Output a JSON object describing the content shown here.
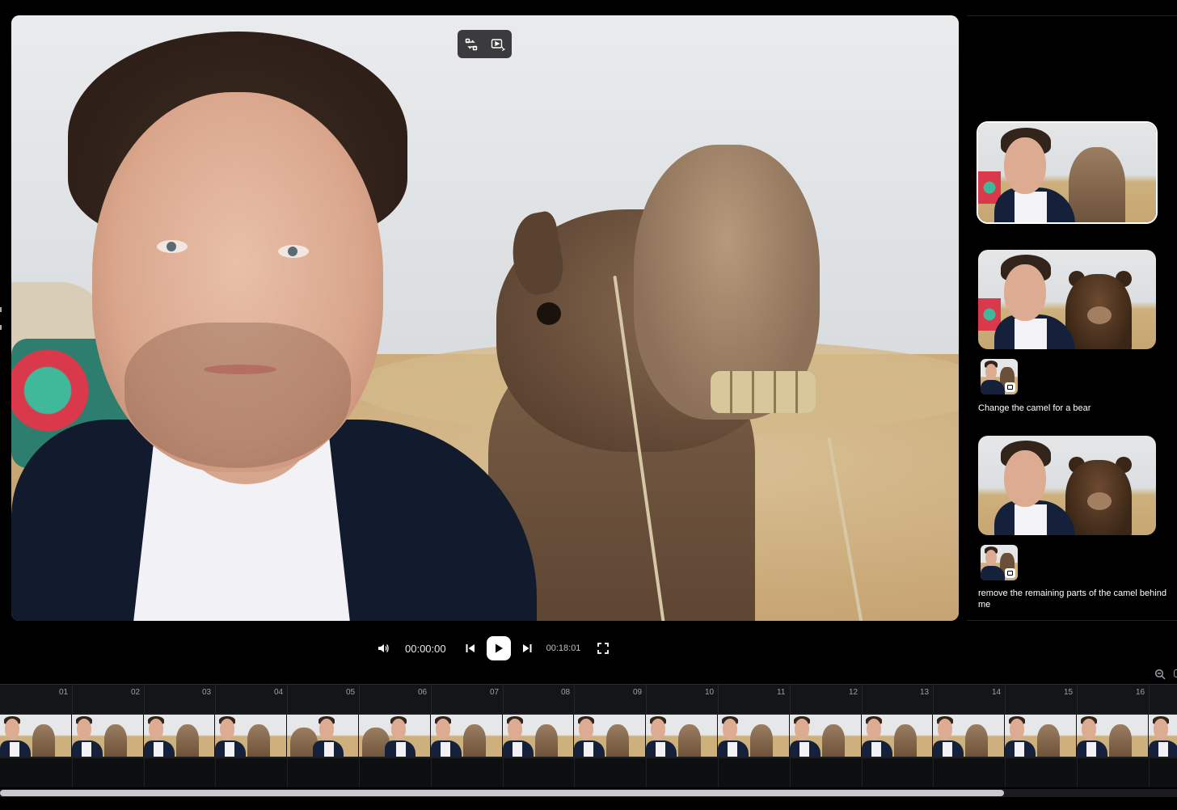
{
  "player": {
    "current_time": "00:00:00",
    "duration": "00:18:01"
  },
  "preview_toolbar": {
    "icons": [
      "swap-compare-icon",
      "video-ai-icon"
    ]
  },
  "history": {
    "items": [
      {
        "variant": "original-camel",
        "prompt": ""
      },
      {
        "variant": "bear",
        "prompt": "Change the camel for a bear"
      },
      {
        "variant": "bear-cleaned",
        "prompt": "remove the remaining parts of the camel behind me"
      }
    ]
  },
  "timeline": {
    "ruler_labels": [
      "01",
      "02",
      "03",
      "04",
      "05",
      "06",
      "07",
      "08",
      "09",
      "10",
      "11",
      "12",
      "13",
      "14",
      "15",
      "16"
    ],
    "zoom_icon": "zoom-out-icon"
  },
  "colors": {
    "background": "#000000",
    "panel": "#141518",
    "accent": "#ffffff"
  }
}
